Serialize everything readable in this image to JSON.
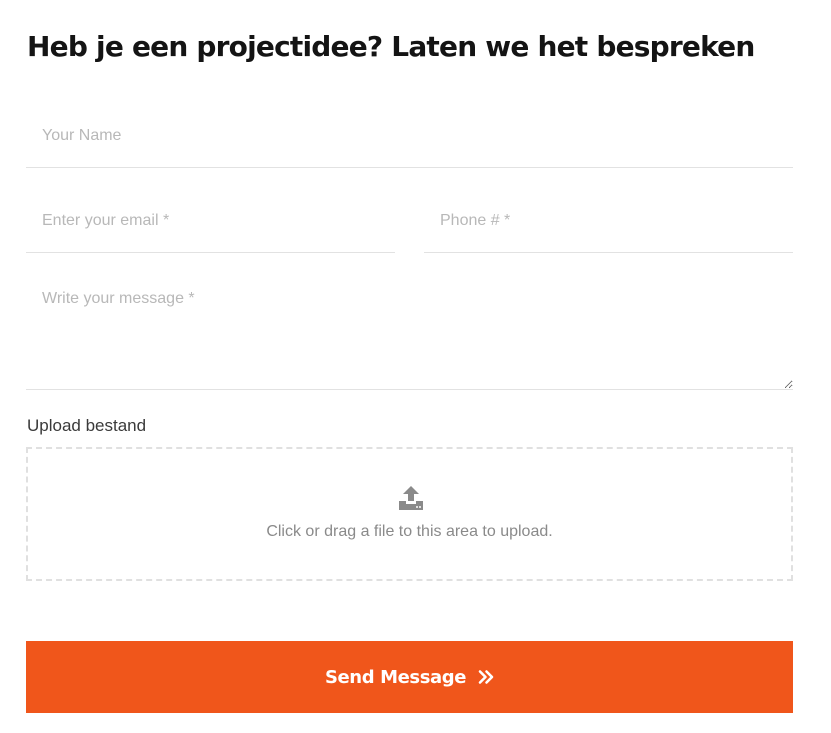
{
  "heading": "Heb je een projectidee? Laten we het bespreken",
  "form": {
    "name_placeholder": "Your Name",
    "email_placeholder": "Enter your email *",
    "phone_placeholder": "Phone # *",
    "message_placeholder": "Write your message *",
    "upload_label": "Upload bestand",
    "upload_hint": "Click or drag a file to this area to upload.",
    "upload_icon": "upload-tray-icon",
    "submit_label": "Send Message",
    "submit_icon": "double-chevron-right-icon"
  },
  "colors": {
    "accent": "#f0561b",
    "heading": "#141414",
    "placeholder": "#b8b8b8",
    "border": "#e2e2e2"
  }
}
